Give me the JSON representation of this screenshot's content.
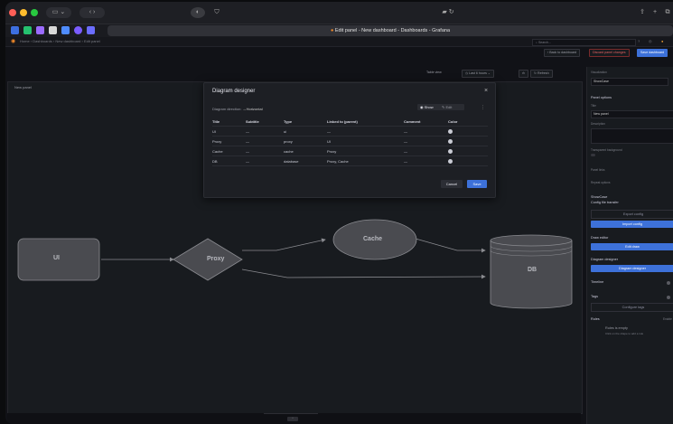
{
  "window": {
    "title": "Edit panel - New dashboard - Dashboards - Grafana"
  },
  "breadcrumb": [
    "Home",
    "Dashboards",
    "New dashboard",
    "Edit panel"
  ],
  "header": {
    "search_placeholder": "Search..."
  },
  "toolbar": {
    "back_label": "Back to dashboard",
    "discard_label": "Discard panel changes",
    "save_dashboard_label": "Save dashboard",
    "table_view_label": "Table view",
    "time_range_label": "Last 6 hours",
    "refresh_label": "Refresh"
  },
  "panel": {
    "title": "New panel"
  },
  "diagram": {
    "nodes": [
      "UI",
      "Proxy",
      "Cache",
      "DB"
    ]
  },
  "modal": {
    "title": "Diagram designer",
    "direction_label": "Diagram direction:",
    "direction_value": "Horizontal",
    "show_label": "Show",
    "edit_label": "Edit",
    "columns": [
      "Title",
      "Subtitle",
      "Type",
      "Linked to (parent)",
      "Comment",
      "Color"
    ],
    "rows": [
      {
        "title": "UI",
        "subtitle": "—",
        "type": "ui",
        "linked": "—",
        "comment": "—"
      },
      {
        "title": "Proxy",
        "subtitle": "—",
        "type": "proxy",
        "linked": "UI",
        "comment": "—"
      },
      {
        "title": "Cache",
        "subtitle": "—",
        "type": "cache",
        "linked": "Proxy",
        "comment": "—"
      },
      {
        "title": "DB",
        "subtitle": "—",
        "type": "database",
        "linked": "Proxy, Cache",
        "comment": "—"
      }
    ],
    "cancel_label": "Cancel",
    "save_label": "Save"
  },
  "sidebar": {
    "visualization_label": "Visualization",
    "visualization_value": "ShowCase",
    "panel_options": "Panel options",
    "title_label": "Title",
    "title_value": "New panel",
    "description_label": "Description",
    "transparent_label": "Transparent background",
    "panel_links": "Panel links",
    "repeat_options": "Repeat options",
    "showcase_label": "ShowCase",
    "config_transfer": "Config file transfer",
    "export_config": "Export config",
    "import_config": "Import config",
    "draw_editor": "Draw editor",
    "edit_draw": "Edit draw",
    "diagram_designer": "Diagram designer",
    "diagram_designer_btn": "Diagram designer",
    "timeline": "Timeline",
    "tags": "Tags",
    "configure_tags": "Configure tags",
    "rules": "Rules",
    "rules_mode": "Enable",
    "rules_empty": "Rules is empty",
    "rules_hint": "Click on the shape to add a rule"
  },
  "colors": {
    "accent": "#3d71d9",
    "node_fill": "#4a4b50",
    "node_stroke": "#8a8b90"
  }
}
